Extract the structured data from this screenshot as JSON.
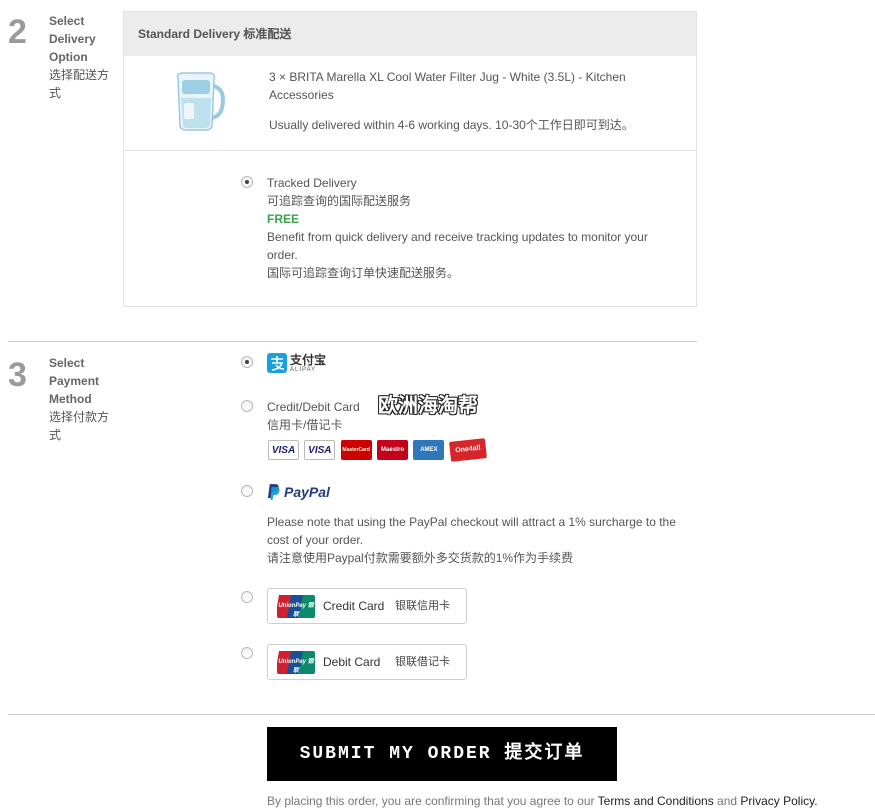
{
  "step2": {
    "number": "2",
    "label_en": "Select Delivery Option",
    "label_cn": "选择配送方式",
    "box_title": "Standard Delivery 标准配送",
    "product_text": "3 × BRITA Marella XL Cool Water Filter Jug - White (3.5L) - Kitchen Accessories",
    "delivery_time": "Usually delivered within 4-6 working days. 10-30个工作日即可到达。",
    "option": {
      "name": "Tracked Delivery",
      "name_cn": "可追踪查询的国际配送服务",
      "price": "FREE",
      "desc": "Benefit from quick delivery and receive tracking updates to monitor your order.",
      "desc_cn": "国际可追踪查询订单快速配送服务。",
      "selected": true
    }
  },
  "step3": {
    "number": "3",
    "label_en": "Select Payment Method",
    "label_cn": "选择付款方式",
    "alipay": {
      "cn": "支付宝",
      "en": "ALIPAY",
      "selected": true
    },
    "card": {
      "label": "Credit/Debit Card",
      "label_cn": "信用卡/借记卡",
      "logos": [
        "VISA",
        "VISA",
        "MasterCard",
        "Maestro",
        "AMEX",
        "One4all"
      ]
    },
    "paypal": {
      "label": "PayPal",
      "note": "Please note that using the PayPal checkout will attract a 1% surcharge to the cost of your order.",
      "note_cn": "请注意使用Paypal付款需要额外多交货款的1%作为手续费"
    },
    "unionpay_credit": {
      "logo": "UnionPay 银联",
      "en": "Credit Card",
      "cn": "银联信用卡"
    },
    "unionpay_debit": {
      "logo": "UnionPay 银联",
      "en": "Debit Card",
      "cn": "银联借记卡"
    }
  },
  "watermark": "欧洲海淘帮",
  "submit": {
    "label": "SUBMIT MY ORDER 提交订单"
  },
  "terms": {
    "prefix": "By placing this order, you are confirming that you agree to our",
    "terms_link": "Terms and Conditions",
    "and": "and",
    "privacy_link": "Privacy Policy."
  },
  "colors": {
    "free": "#3aa34a",
    "submit_bg": "#000000",
    "paypal_dark": "#253b80",
    "paypal_light": "#179bd7",
    "alipay": "#1a9fe0"
  },
  "icons": [
    "water-jug-image",
    "alipay-icon",
    "paypal-icon",
    "unionpay-logo-icon"
  ]
}
